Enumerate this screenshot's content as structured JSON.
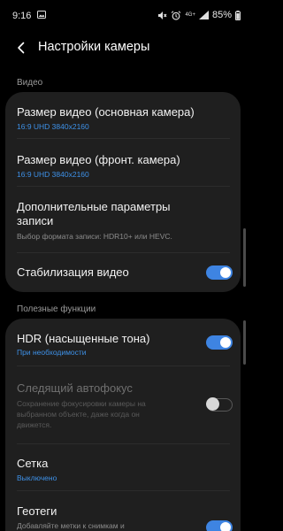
{
  "status_bar": {
    "time": "9:16",
    "network_type": "4G+",
    "battery_percent": "85%"
  },
  "header": {
    "title": "Настройки камеры"
  },
  "sections": {
    "video": {
      "title": "Видео",
      "items": [
        {
          "title": "Размер видео (основная камера)",
          "subtitle": "16:9 UHD 3840x2160"
        },
        {
          "title": "Размер видео (фронт. камера)",
          "subtitle": "16:9 UHD 3840x2160"
        },
        {
          "title_line1": "Дополнительные параметры",
          "title_line2": "записи",
          "subtitle": "Выбор формата записи: HDR10+ или HEVC."
        },
        {
          "title": "Стабилизация видео",
          "toggle": true
        }
      ]
    },
    "useful": {
      "title": "Полезные функции",
      "items": [
        {
          "title": "HDR (насыщенные тона)",
          "subtitle": "При необходимости",
          "toggle": true
        },
        {
          "title": "Следящий автофокус",
          "subtitle_line1": "Сохранение фокусировки камеры на",
          "subtitle_line2": "выбранном объекте, даже когда он",
          "subtitle_line3": "движется.",
          "toggle": false,
          "disabled": true
        },
        {
          "title": "Сетка",
          "subtitle": "Выключено"
        },
        {
          "title": "Геотеги",
          "subtitle": "Добавляйте метки к снимкам и",
          "toggle": true
        }
      ]
    }
  },
  "colors": {
    "background": "#000000",
    "card": "#1f1f1f",
    "accent": "#3e84e2",
    "subtitle_blue": "#3e91e8"
  }
}
